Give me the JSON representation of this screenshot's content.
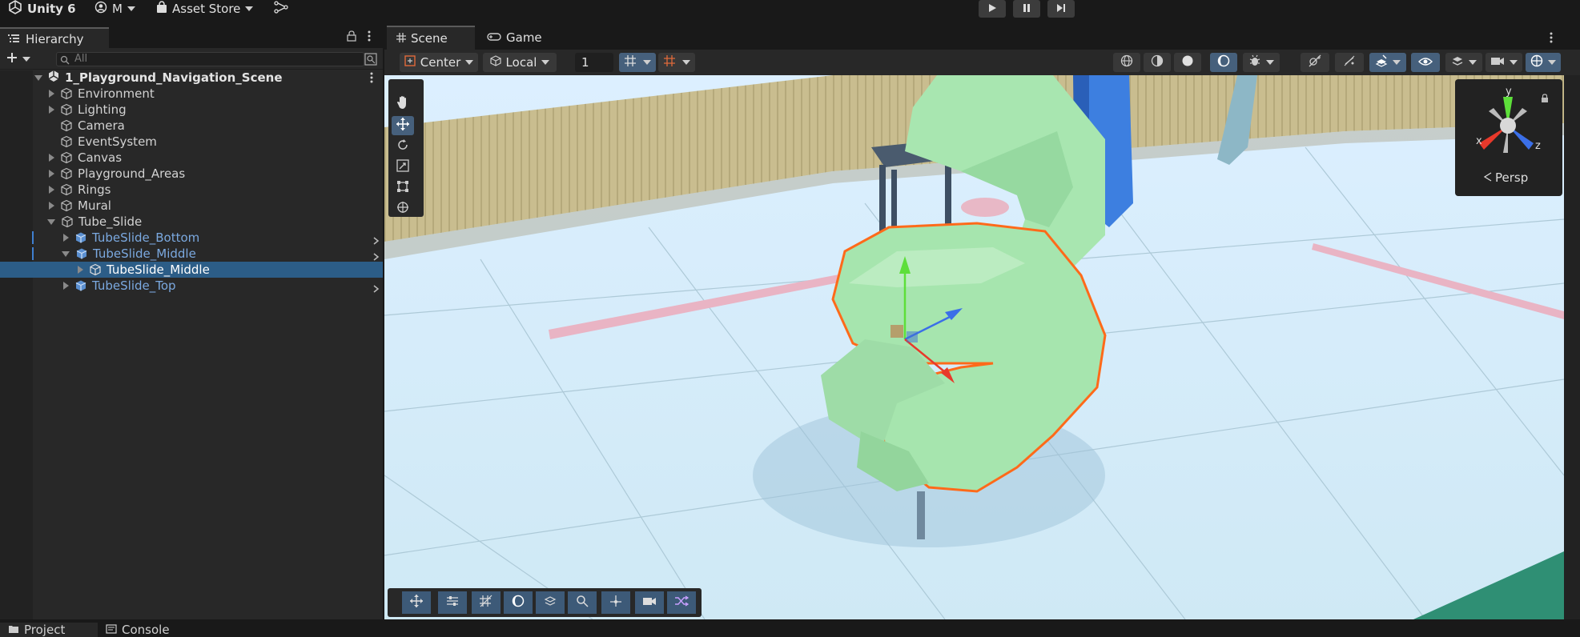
{
  "topbar": {
    "app_title": "Unity 6",
    "account_label": "M",
    "asset_store_label": "Asset Store"
  },
  "hierarchy": {
    "tab_label": "Hierarchy",
    "search_placeholder": "All",
    "scene_name": "1_Playground_Navigation_Scene",
    "items": [
      {
        "label": "Environment"
      },
      {
        "label": "Lighting"
      },
      {
        "label": "Camera"
      },
      {
        "label": "EventSystem"
      },
      {
        "label": "Canvas"
      },
      {
        "label": "Playground_Areas"
      },
      {
        "label": "Rings"
      },
      {
        "label": "Mural"
      },
      {
        "label": "Tube_Slide"
      },
      {
        "label": "TubeSlide_Bottom"
      },
      {
        "label": "TubeSlide_Middle"
      },
      {
        "label": "TubeSlide_Middle"
      },
      {
        "label": "TubeSlide_Top"
      }
    ]
  },
  "scene": {
    "tab_scene": "Scene",
    "tab_game": "Game",
    "pivot_label": "Center",
    "space_label": "Local",
    "grid_value": "1",
    "gizmo_persp": "Persp",
    "axis_x": "x",
    "axis_y": "y",
    "axis_z": "z"
  },
  "bottom_tabs": {
    "project": "Project",
    "console": "Console"
  },
  "colors": {
    "selection": "#2c5d87",
    "prefab_text": "#7ba9e0",
    "outline": "#ff6a1a",
    "slide_green": "#a8e6b0"
  }
}
